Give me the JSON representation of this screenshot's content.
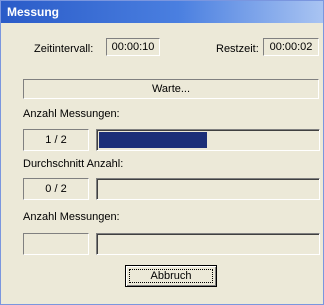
{
  "window": {
    "title": "Messung"
  },
  "timing": {
    "interval_label": "Zeitintervall:",
    "interval_value": "00:00:10",
    "remaining_label": "Restzeit:",
    "remaining_value": "00:00:02"
  },
  "status": {
    "text": "Warte..."
  },
  "section1": {
    "label": "Anzahl Messungen:",
    "count": "1 / 2",
    "progress": 0.5,
    "progress_color": "#1c2f78"
  },
  "section2": {
    "label": "Durchschnitt Anzahl:",
    "count": "0 / 2",
    "progress": 0
  },
  "section3": {
    "label": "Anzahl Messungen:",
    "count": "",
    "progress": 0
  },
  "actions": {
    "cancel_label": "Abbruch"
  }
}
